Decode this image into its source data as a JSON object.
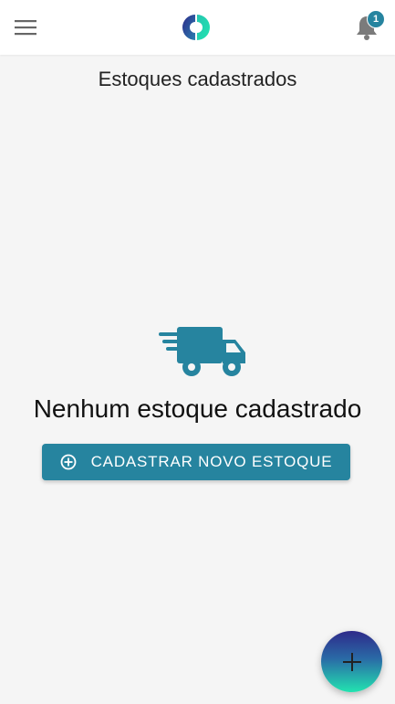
{
  "header": {
    "menu_icon": "hamburger-menu-icon",
    "logo_icon": "brand-logo-icon",
    "notifications_icon": "bell-icon",
    "notification_count": "1"
  },
  "page": {
    "title": "Estoques cadastrados"
  },
  "empty_state": {
    "icon": "delivery-truck-icon",
    "message": "Nenhum estoque cadastrado",
    "button_icon": "plus-circle-icon",
    "button_label": "CADASTRAR NOVO ESTOQUE"
  },
  "fab": {
    "icon": "plus-icon"
  },
  "colors": {
    "accent": "#26849f",
    "background": "#f5f5f5",
    "fab_gradient_top": "#2e2a8a",
    "fab_gradient_bottom": "#22e3b0"
  }
}
